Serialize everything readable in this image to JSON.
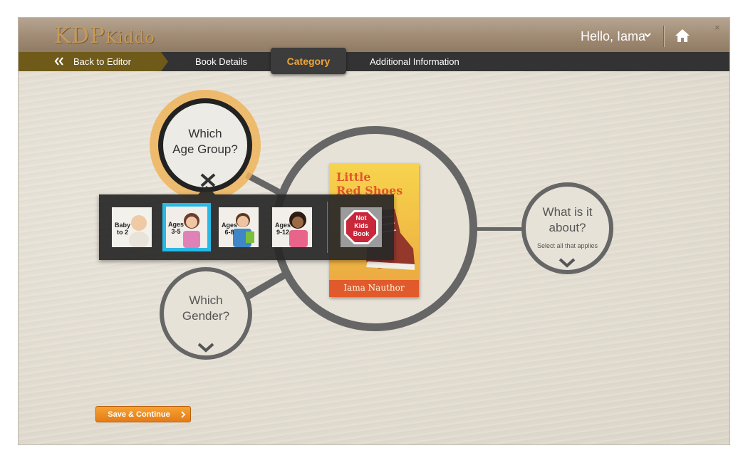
{
  "header": {
    "logo_main": "KDP",
    "logo_sub": "Kiddo",
    "greeting": "Hello, Iama",
    "home_icon": "home-icon",
    "close_glyph": "×"
  },
  "nav": {
    "back_label": "Back to Editor",
    "tabs": [
      {
        "label": "Book Details",
        "active": false
      },
      {
        "label": "Category",
        "active": true
      },
      {
        "label": "Additional Information",
        "active": false
      }
    ]
  },
  "age_group": {
    "title_line1": "Which",
    "title_line2": "Age Group?",
    "options": [
      {
        "line1": "Baby",
        "line2": "to 2",
        "selected": false
      },
      {
        "line1": "Ages",
        "line2": "3-5",
        "selected": true
      },
      {
        "line1": "Ages",
        "line2": "6-8",
        "selected": false
      },
      {
        "line1": "Ages",
        "line2": "9-12",
        "selected": false
      }
    ],
    "not_kids": {
      "line1": "Not",
      "line2": "Kids",
      "line3": "Book"
    }
  },
  "book": {
    "title_line1": "Little",
    "title_line2": "Red Shoes",
    "author": "Iama Nauthor"
  },
  "about": {
    "title_line1": "What is it",
    "title_line2": "about?",
    "hint": "Select all that applies"
  },
  "gender": {
    "title_line1": "Which",
    "title_line2": "Gender?"
  },
  "actions": {
    "save_label": "Save & Continue"
  },
  "colors": {
    "accent_orange": "#f0a63a",
    "selected_tile_border": "#29b9e6",
    "save_button": "#e57c17",
    "not_kids_octagon": "#c9273a"
  }
}
